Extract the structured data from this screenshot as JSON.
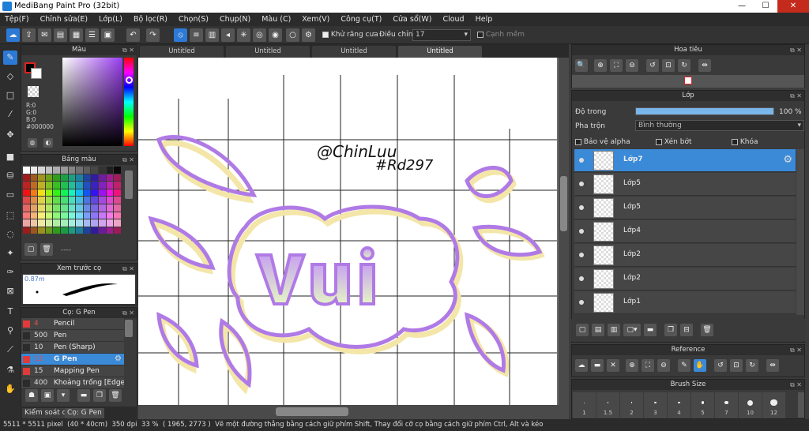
{
  "window": {
    "title": "MediBang Paint Pro (32bit)"
  },
  "menu": [
    "Tệp(F)",
    "Chỉnh sửa(E)",
    "Lớp(L)",
    "Bộ lọc(R)",
    "Chọn(S)",
    "Chụp(N)",
    "Màu (C)",
    "Xem(V)",
    "Công cụ(T)",
    "Cửa sổ(W)",
    "Cloud",
    "Help"
  ],
  "toolbar": {
    "antialias_label": "Khử răng cưa",
    "adjust_label": "Điều chỉnh",
    "adjust_value": "17",
    "sharp_label": "Cạnh mềm"
  },
  "tabs": [
    "Untitled",
    "Untitled",
    "Untitled",
    "Untitled"
  ],
  "color_panel": {
    "title": "Màu",
    "r": "R:0",
    "g": "G:0",
    "b": "B:0",
    "hex": "#000000"
  },
  "palette_panel": {
    "title": "Bảng màu",
    "extra": "----"
  },
  "preview_panel": {
    "title": "Xem trước cọ",
    "size": "0.87m"
  },
  "brush_panel": {
    "title": "Cọ: G Pen",
    "items": [
      {
        "color": "#e03a3a",
        "size": "4",
        "name": "Pencil"
      },
      {
        "color": "#2b2b2b",
        "size": "500",
        "name": "Pen"
      },
      {
        "color": "#2b2b2b",
        "size": "10",
        "name": "Pen (Sharp)"
      },
      {
        "color": "#e03a3a",
        "size": "12",
        "name": "G Pen",
        "selected": true
      },
      {
        "color": "#e03a3a",
        "size": "15",
        "name": "Mapping Pen"
      },
      {
        "color": "#2b2b2b",
        "size": "400",
        "name": "Khoảng trống [Edge I"
      }
    ],
    "tabs": [
      "Kiểm soát cọ",
      "Cọ: G Pen"
    ]
  },
  "navigator": {
    "title": "Hoa tiêu"
  },
  "layer_panel": {
    "title": "Lớp",
    "opacity_label": "Độ trong",
    "opacity_value": "100 %",
    "opacity": 1.0,
    "blend_label": "Pha trộn",
    "blend_value": "Bình thường",
    "protect_alpha": "Bảo vệ alpha",
    "clip": "Xén bớt",
    "lock": "Khóa",
    "layers": [
      "Lớp7",
      "Lớp5",
      "Lớp5",
      "Lớp4",
      "Lớp2",
      "Lớp2",
      "Lớp1"
    ]
  },
  "reference_panel": {
    "title": "Reference"
  },
  "brush_size_panel": {
    "title": "Brush Size",
    "sizes": [
      "1",
      "1.5",
      "2",
      "3",
      "4",
      "5",
      "7",
      "10",
      "12"
    ]
  },
  "canvas": {
    "signature_line1": "@ChinLuu",
    "signature_line2": "#Rd297"
  },
  "status": {
    "size": "5511 * 5511 pixel",
    "cm": "(40 * 40cm)",
    "dpi": "350 dpi",
    "zoom": "33 %",
    "coords": "( 1965, 2773 )",
    "hint": "Vẽ một đường thẳng bằng cách giữ phím Shift, Thay đổi cỡ cọ bằng cách giữ phím Ctrl, Alt và kéo"
  },
  "colors": {
    "accent": "#3a8ad8",
    "purple_stroke": "#b07ae6",
    "yellow_stroke": "#f3e6a8"
  }
}
